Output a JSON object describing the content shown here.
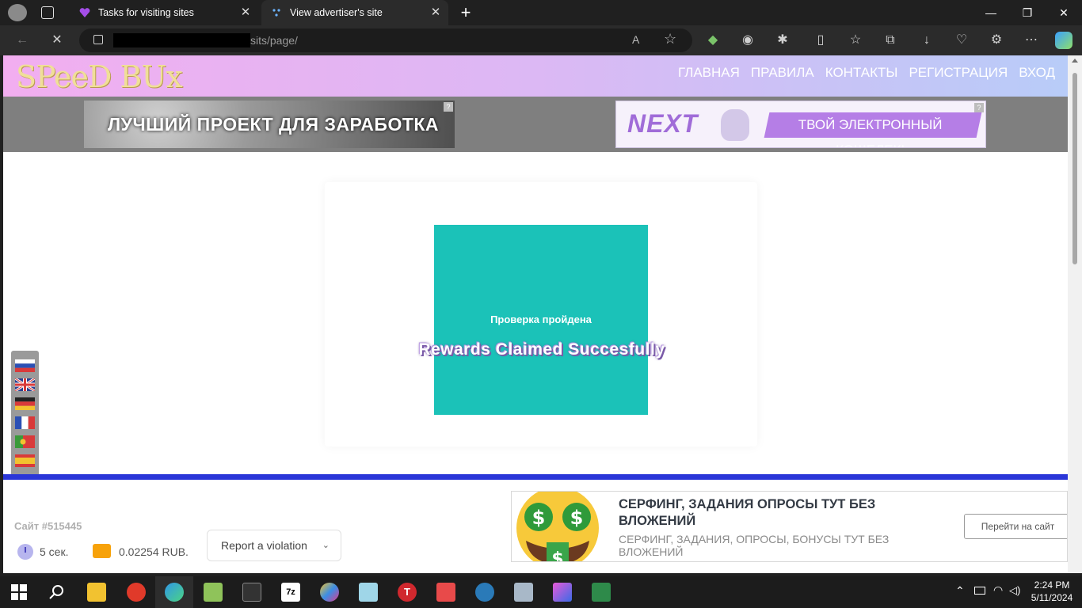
{
  "browser": {
    "tabs": [
      {
        "title": "Tasks for visiting sites",
        "active": false
      },
      {
        "title": "View advertiser's site",
        "active": true
      }
    ],
    "new_tab_symbol": "+",
    "url_visible": "sits/page/",
    "window_controls": [
      "minimize",
      "restore",
      "close"
    ]
  },
  "site": {
    "logo": "SPeeD BUx",
    "nav": [
      "ГЛАВНАЯ",
      "ПРАВИЛА",
      "КОНТАКТЫ",
      "РЕГИСТРАЦИЯ",
      "ВХОД"
    ],
    "banner_left": "ЛУЧШИЙ ПРОЕКТ ДЛЯ ЗАРАБОТКА",
    "banner_right_logo": "NEXT",
    "banner_right_slogan": "ТВОЙ ЭЛЕКТРОННЫЙ КОШЕЛЕК!",
    "banner_q": "?",
    "verify_text": "Проверка пройдена",
    "rewards_text": "Rewards Claimed Succesfully",
    "languages": [
      "ru",
      "en",
      "de",
      "fr",
      "pt",
      "es"
    ]
  },
  "footer": {
    "site_id": "Сайт #515445",
    "timer": "5 сек.",
    "reward": "0.02254 RUB.",
    "report_label": "Report a violation",
    "ad_title": "СЕРФИНГ, ЗАДАНИЯ ОПРОСЫ ТУТ БЕЗ ВЛОЖЕНИЙ",
    "ad_desc": "СЕРФИНГ, ЗАДАНИЯ, ОПРОСЫ, БОНУСЫ ТУТ БЕЗ ВЛОЖЕНИЙ",
    "ad_button": "Перейти на сайт"
  },
  "taskbar": {
    "time": "2:24 PM",
    "date": "5/11/2024"
  },
  "colors": {
    "teal": "#1bc2b8",
    "blue_line": "#2a36d8",
    "reward_icon": "#f7a20a"
  }
}
